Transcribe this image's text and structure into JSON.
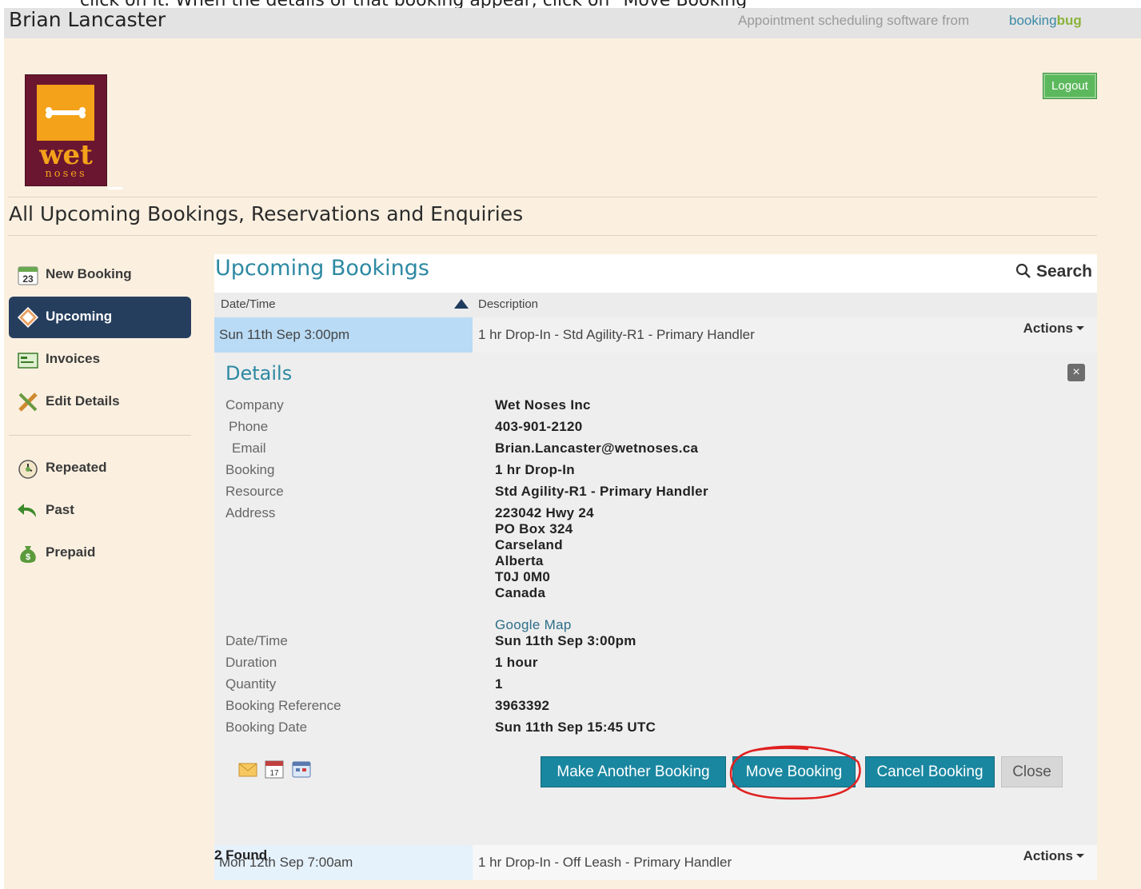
{
  "caption": "click on it. When the details of that booking appear, click on \"Move Booking\"",
  "topbar": {
    "user_name": "Brian Lancaster",
    "powered_by": "Appointment scheduling software from",
    "brand_a": "booking",
    "brand_b": "bug"
  },
  "logo": {
    "word": "wet",
    "sub": "noses"
  },
  "logout_label": "Logout",
  "page_title": "All Upcoming Bookings, Reservations and Enquiries",
  "sidebar": {
    "items": [
      {
        "label": "New Booking",
        "icon": "calendar-icon"
      },
      {
        "label": "Upcoming",
        "icon": "bookmark-icon"
      },
      {
        "label": "Invoices",
        "icon": "invoice-icon"
      },
      {
        "label": "Edit Details",
        "icon": "pencil-icon"
      },
      {
        "label": "Repeated",
        "icon": "clock-icon"
      },
      {
        "label": "Past",
        "icon": "undo-arrow-icon"
      },
      {
        "label": "Prepaid",
        "icon": "money-bag-icon"
      }
    ],
    "calendar_day": "23"
  },
  "main": {
    "title": "Upcoming Bookings",
    "search_label": "Search",
    "columns": [
      "Date/Time",
      "Description"
    ],
    "rows": [
      {
        "datetime": "Sun 11th Sep 3:00pm",
        "description": "1 hr Drop-In - Std Agility-R1 - Primary Handler",
        "actions": "Actions"
      },
      {
        "datetime": "Mon 12th Sep 7:00am",
        "description": "1 hr Drop-In - Off Leash - Primary Handler",
        "actions": "Actions"
      }
    ],
    "found": "2 Found"
  },
  "details": {
    "title": "Details",
    "close_glyph": "×",
    "labels": {
      "company": "Company",
      "phone": "Phone",
      "email": "Email",
      "booking": "Booking",
      "resource": "Resource",
      "address": "Address",
      "datetime": "Date/Time",
      "duration": "Duration",
      "quantity": "Quantity",
      "reference": "Booking Reference",
      "booking_date": "Booking Date"
    },
    "values": {
      "company": "Wet Noses Inc",
      "phone": "403-901-2120",
      "email": "Brian.Lancaster@wetnoses.ca",
      "booking": "1 hr Drop-In",
      "resource": "Std Agility-R1 - Primary Handler",
      "address": [
        "223042 Hwy 24",
        "PO Box 324",
        "Carseland",
        "Alberta",
        "T0J 0M0",
        "Canada"
      ],
      "map_link": "Google Map",
      "datetime": "Sun 11th Sep 3:00pm",
      "duration": "1 hour",
      "quantity": "1",
      "reference": "3963392",
      "booking_date": "Sun 11th Sep 15:45 UTC"
    },
    "calendar_icon_day": "17",
    "buttons": {
      "make_another": "Make Another Booking",
      "move": "Move Booking",
      "cancel": "Cancel Booking",
      "close": "Close"
    }
  },
  "colors": {
    "accent": "#2d89a3",
    "button": "#1a87a0",
    "nav_active": "#263e5e",
    "page_bg": "#fbf0e0",
    "logout": "#5cb85c",
    "annotation": "#e02020"
  }
}
